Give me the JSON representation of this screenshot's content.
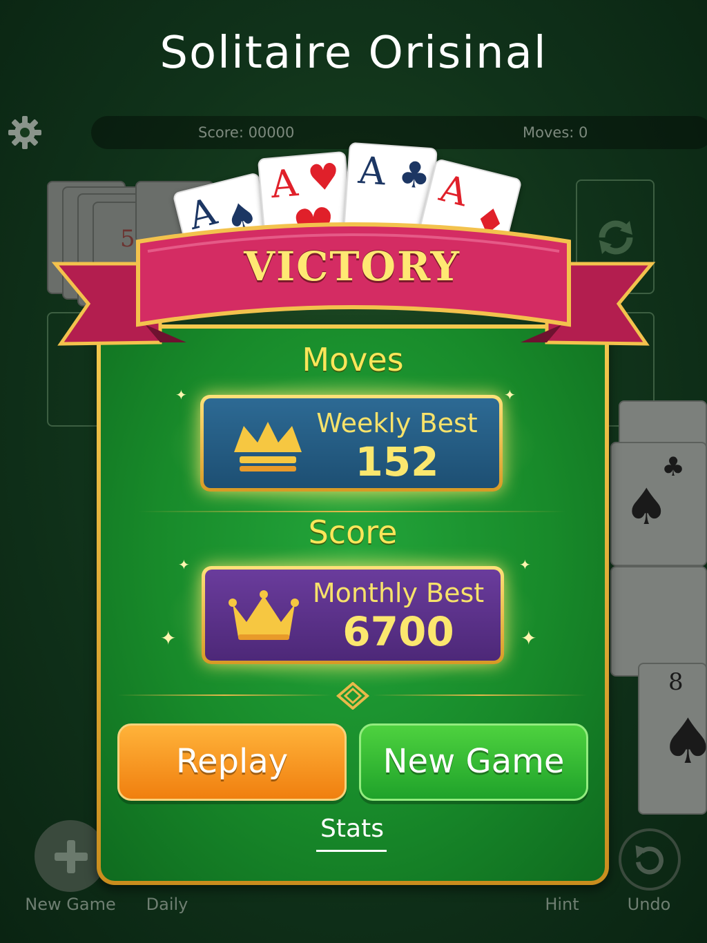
{
  "header": {
    "title": "Solitaire Orisinal"
  },
  "status": {
    "score": "Score: 00000",
    "moves": "Moves: 0"
  },
  "icons": {
    "settings": "gear-icon",
    "recycle": "refresh-icon",
    "new_game": "plus-icon",
    "undo": "undo-icon",
    "crown": "crown-icon",
    "sparkle": "sparkle-icon",
    "diamond": "diamond-ornament-icon"
  },
  "background_cards": {
    "stock_rank": "5",
    "tableau_ranks": [
      "8"
    ]
  },
  "victory": {
    "banner": "VICTORY",
    "aces": [
      {
        "rank": "A",
        "suit": "♠"
      },
      {
        "rank": "A",
        "suit": "♥"
      },
      {
        "rank": "A",
        "suit": "♣"
      },
      {
        "rank": "A",
        "suit": "♦"
      }
    ],
    "moves_section": {
      "label": "Moves",
      "best_title": "Weekly Best",
      "best_value": "152"
    },
    "score_section": {
      "label": "Score",
      "best_title": "Monthly Best",
      "best_value": "6700"
    },
    "buttons": {
      "replay": "Replay",
      "new_game": "New Game"
    },
    "stats_link": "Stats"
  },
  "toolbar": {
    "new_game": "New Game",
    "daily": "Daily",
    "hint": "Hint",
    "undo": "Undo"
  },
  "colors": {
    "felt": "#188a2a",
    "gold": "#f7e26a",
    "ribbon": "#c8245a",
    "replay": "#f59a24",
    "new_game": "#33bb35",
    "moves_box": "#2d6a94",
    "score_box": "#6a3c9c"
  }
}
